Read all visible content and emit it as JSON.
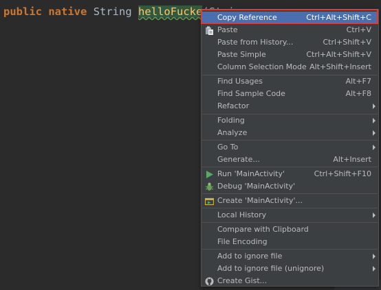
{
  "code": {
    "kw1": "public",
    "kw2": "native",
    "type": "String",
    "method": "helloFucke",
    "rest": "(Strin"
  },
  "menu": {
    "items": [
      {
        "label": "Copy Reference",
        "shortcut": "Ctrl+Alt+Shift+C",
        "selected": true
      },
      {
        "label": "Paste",
        "shortcut": "Ctrl+V",
        "icon": "paste-icon"
      },
      {
        "label": "Paste from History...",
        "shortcut": "Ctrl+Shift+V"
      },
      {
        "label": "Paste Simple",
        "shortcut": "Ctrl+Alt+Shift+V"
      },
      {
        "label": "Column Selection Mode",
        "shortcut": "Alt+Shift+Insert"
      },
      {
        "label": "Find Usages",
        "shortcut": "Alt+F7"
      },
      {
        "label": "Find Sample Code",
        "shortcut": "Alt+F8"
      },
      {
        "label": "Refactor",
        "submenu": true
      },
      {
        "label": "Folding",
        "submenu": true
      },
      {
        "label": "Analyze",
        "submenu": true
      },
      {
        "label": "Go To",
        "submenu": true
      },
      {
        "label": "Generate...",
        "shortcut": "Alt+Insert"
      },
      {
        "label": "Run 'MainActivity'",
        "shortcut": "Ctrl+Shift+F10",
        "icon": "run-icon"
      },
      {
        "label": "Debug 'MainActivity'",
        "icon": "debug-icon"
      },
      {
        "label": "Create 'MainActivity'...",
        "icon": "create-config-icon"
      },
      {
        "label": "Local History",
        "submenu": true
      },
      {
        "label": "Compare with Clipboard"
      },
      {
        "label": "File Encoding"
      },
      {
        "label": "Add to ignore file",
        "submenu": true
      },
      {
        "label": "Add to ignore file (unignore)",
        "submenu": true
      },
      {
        "label": "Create Gist...",
        "icon": "github-icon"
      }
    ]
  },
  "colors": {
    "menu_bg": "#3c3f41",
    "selection": "#4b6eaf",
    "highlight_outline": "#e53935",
    "run_green": "#59a869"
  }
}
